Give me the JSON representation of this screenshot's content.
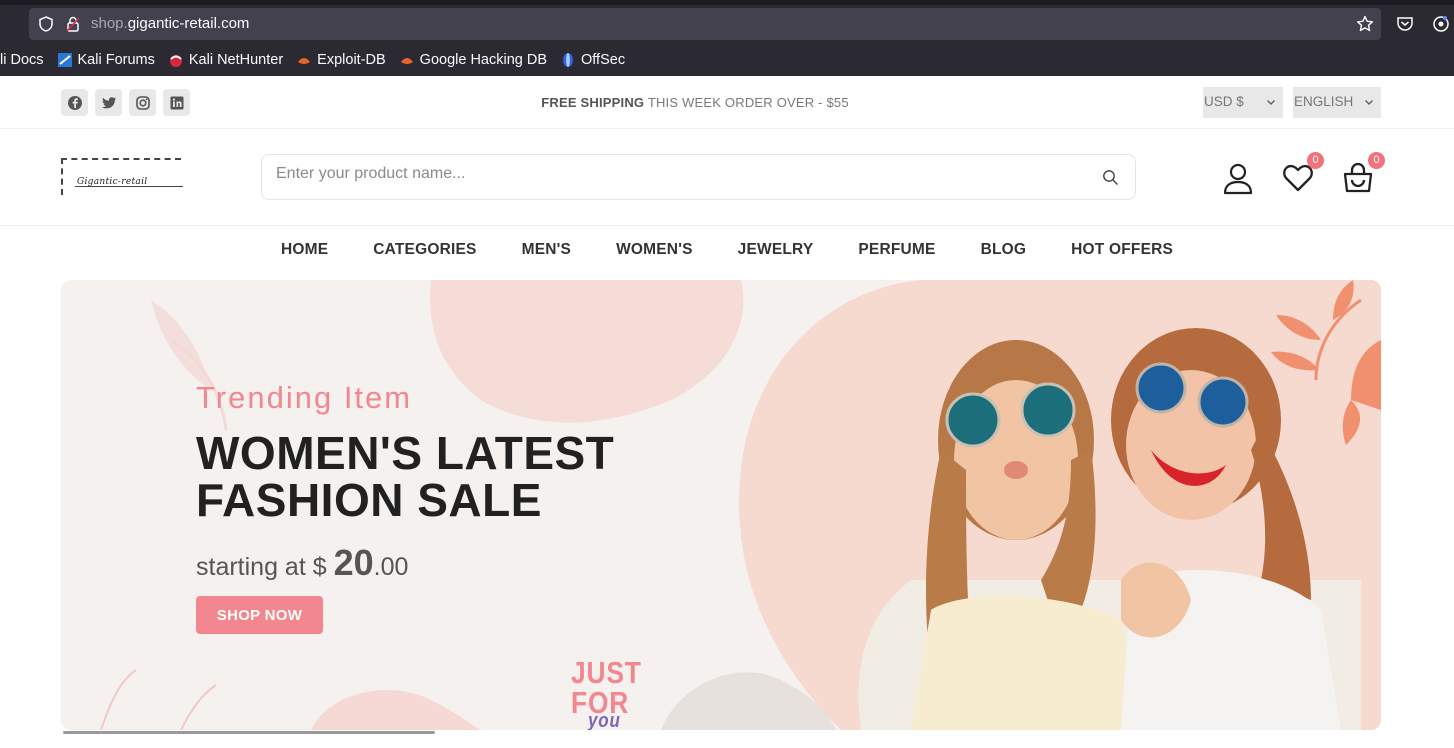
{
  "browser": {
    "url_host_prefix": "shop.",
    "url_host_main": "gigantic-retail.com",
    "bookmarks": [
      {
        "label": "li Docs",
        "icon": "kali-docs-icon"
      },
      {
        "label": "Kali Forums",
        "icon": "kali-forums-icon"
      },
      {
        "label": "Kali NetHunter",
        "icon": "kali-nethunter-icon"
      },
      {
        "label": "Exploit-DB",
        "icon": "exploit-db-icon"
      },
      {
        "label": "Google Hacking DB",
        "icon": "ghdb-icon"
      },
      {
        "label": "OffSec",
        "icon": "offsec-icon"
      }
    ]
  },
  "topbar": {
    "social": [
      "facebook-icon",
      "twitter-icon",
      "instagram-icon",
      "linkedin-icon"
    ],
    "shipping_bold": "FREE SHIPPING",
    "shipping_rest": "THIS WEEK ORDER OVER - $55",
    "currency": "USD $",
    "language": "ENGLISH"
  },
  "header": {
    "logo_text": "Gigantic-retail",
    "search_placeholder": "Enter your product name...",
    "wishlist_count": "0",
    "cart_count": "0"
  },
  "nav": {
    "items": [
      "HOME",
      "CATEGORIES",
      "MEN'S",
      "WOMEN'S",
      "JEWELRY",
      "PERFUME",
      "BLOG",
      "HOT OFFERS"
    ]
  },
  "hero": {
    "subtitle": "Trending Item",
    "title_line1": "WOMEN'S LATEST",
    "title_line2": "FASHION SALE",
    "price_prefix": "starting at $ ",
    "price_big": "20",
    "price_cents": ".00",
    "button": "SHOP NOW",
    "tag_line1": "JUST",
    "tag_line2": "FOR",
    "tag_line3": "you"
  },
  "colors": {
    "accent": "#f3878f",
    "badge": "#f1727c",
    "hero_bg": "#f4f1ee",
    "browser_bg": "#2b2a33"
  }
}
